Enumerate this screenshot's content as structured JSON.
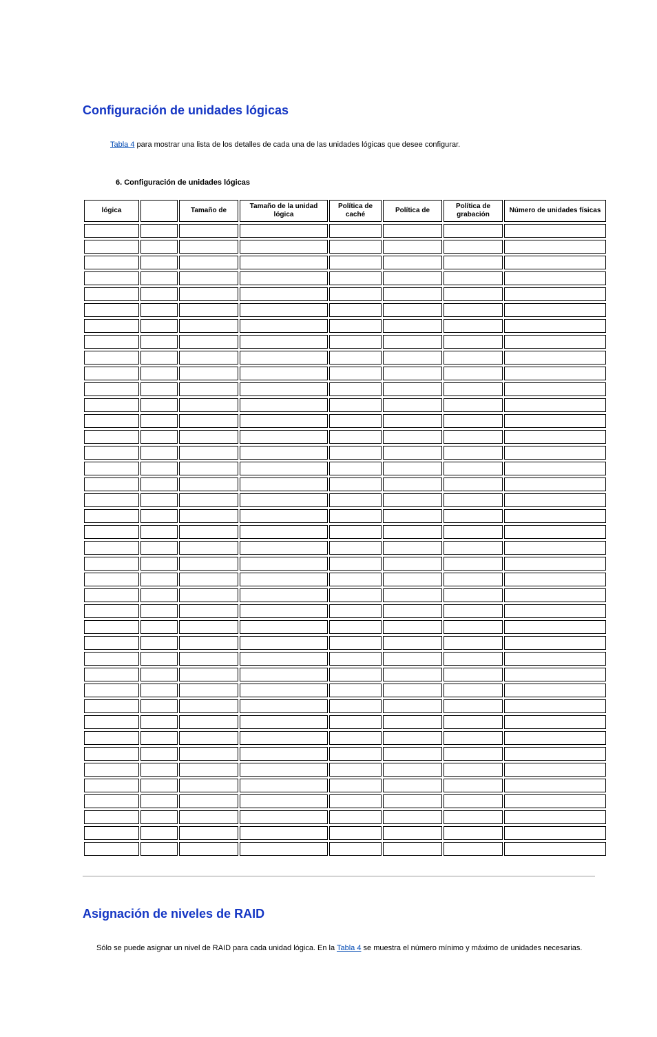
{
  "section1": {
    "title": "Configuración de unidades lógicas",
    "intro_link": "Tabla 4",
    "intro_rest": " para mostrar una lista de los detalles de cada una de las unidades lógicas que desee configurar.",
    "caption": "6. Configuración de unidades lógicas",
    "headers": [
      "lógica",
      "",
      "Tamaño de",
      "Tamaño de la unidad lógica",
      "Política de caché",
      "Política de",
      "Política de grabación",
      "Número de unidades físicas"
    ],
    "row_count": 40
  },
  "section2": {
    "title": "Asignación de niveles de RAID",
    "para_before": "Sólo se puede asignar un nivel de RAID para cada unidad lógica. En la ",
    "para_link": "Tabla 4",
    "para_after": " se muestra el número mínimo y máximo de unidades necesarias."
  }
}
